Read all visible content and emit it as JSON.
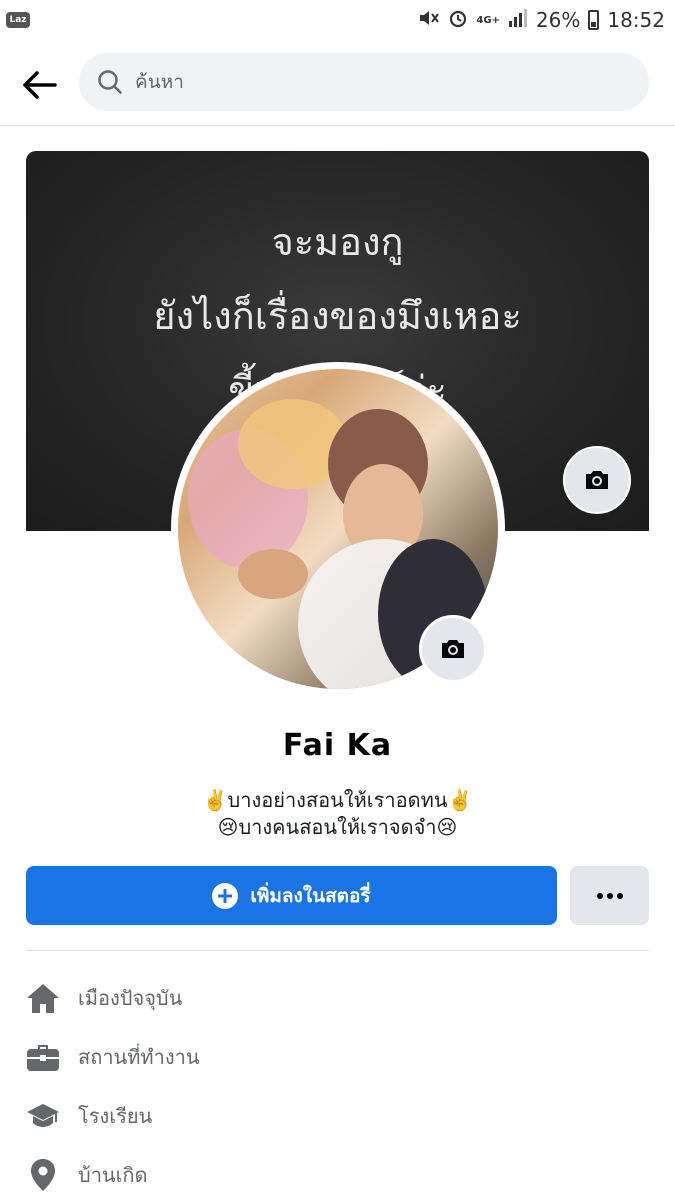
{
  "status_bar": {
    "app_badge": "Laz",
    "network": "4G+",
    "battery": "26%",
    "time": "18:52"
  },
  "search": {
    "placeholder": "ค้นหา"
  },
  "cover": {
    "lines": [
      "จะมองกู",
      "ยังไงก็เรื่องของมึงเหอะ",
      "ขี้เกียจแคร์ว่ะ"
    ]
  },
  "profile": {
    "name": "Fai Ka",
    "bio_line1": "✌️บางอย่างสอนให้เราอดทน✌️",
    "bio_line2": "😢บางคนสอนให้เราจดจำ😢"
  },
  "actions": {
    "add_story_label": "เพิ่มลงในสตอรี่"
  },
  "details": [
    {
      "icon": "home-icon",
      "label": "เมืองปัจจุบัน"
    },
    {
      "icon": "briefcase-icon",
      "label": "สถานที่ทำงาน"
    },
    {
      "icon": "graduation-cap-icon",
      "label": "โรงเรียน"
    },
    {
      "icon": "location-pin-icon",
      "label": "บ้านเกิด"
    }
  ],
  "colors": {
    "primary_blue": "#1b74e4",
    "secondary_button": "#e4e6eb",
    "secondary_text": "#65676b"
  }
}
